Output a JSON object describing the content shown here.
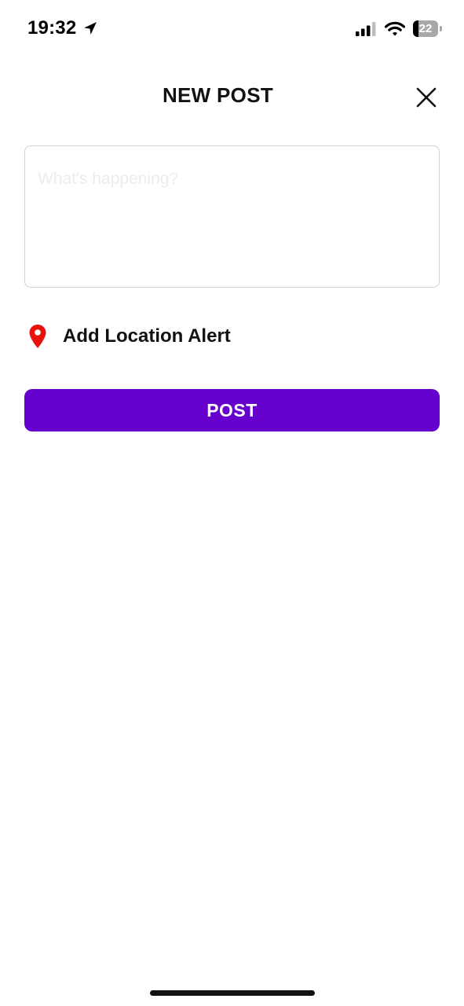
{
  "status_bar": {
    "time": "19:32",
    "battery_percent": 22,
    "battery_text": "22",
    "signal_bars": 3,
    "icons": [
      "location-arrow-icon",
      "cellular-signal-icon",
      "wifi-icon",
      "battery-icon"
    ]
  },
  "header": {
    "title": "NEW POST",
    "close_icon": "close-icon"
  },
  "composer": {
    "value": "",
    "placeholder": "What's happening?"
  },
  "location": {
    "label": "Add Location Alert",
    "icon": "map-pin-icon",
    "icon_color": "#e8130f"
  },
  "actions": {
    "post_label": "POST",
    "accent_color": "#6600cc"
  }
}
